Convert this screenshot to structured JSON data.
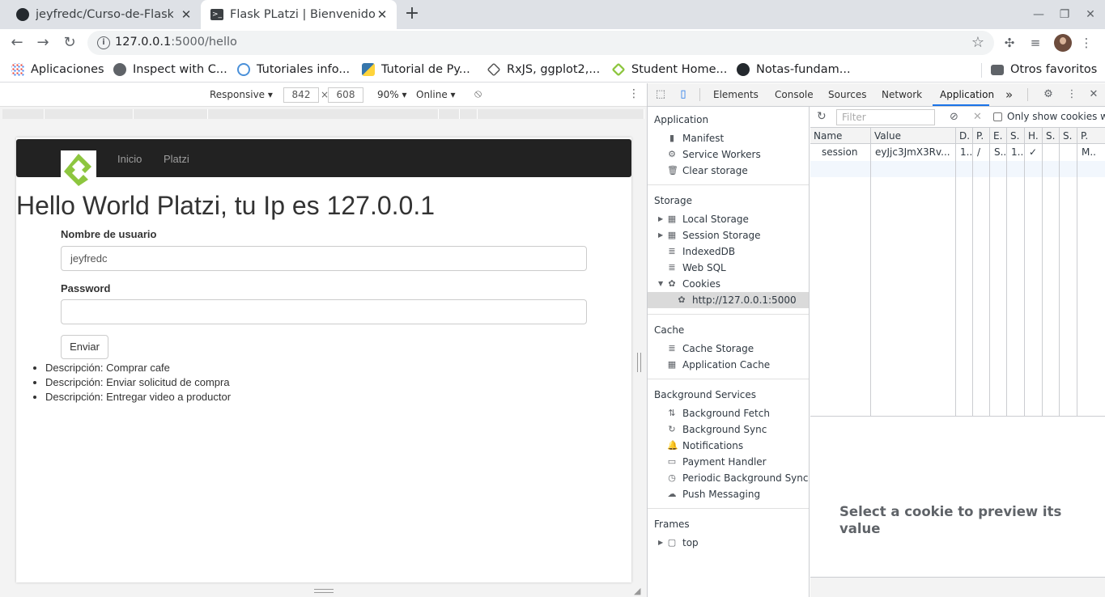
{
  "browser": {
    "tabs": [
      {
        "title": "jeyfredc/Curso-de-Flask: C",
        "icon": "github-icon",
        "active": false
      },
      {
        "title": "Flask PLatzi | Bienvenido",
        "icon": "terminal-icon",
        "active": true
      }
    ],
    "url_host": "127.0.0.1",
    "url_rest": ":5000/hello",
    "bookmarks": [
      {
        "label": "Aplicaciones",
        "icon": "apps-grid-icon"
      },
      {
        "label": "Inspect with C...",
        "icon": "globe-icon"
      },
      {
        "label": "Tutoriales info...",
        "icon": "q-icon"
      },
      {
        "label": "Tutorial de Py...",
        "icon": "python-icon"
      },
      {
        "label": "RxJS, ggplot2,...",
        "icon": "diamond-icon"
      },
      {
        "label": "Student Home...",
        "icon": "student-icon"
      },
      {
        "label": "Notas-fundam...",
        "icon": "github-icon"
      }
    ],
    "other_bookmarks": "Otros favoritos"
  },
  "device_toolbar": {
    "mode": "Responsive",
    "width": "842",
    "times": "×",
    "height": "608",
    "zoom": "90%",
    "network": "Online"
  },
  "page": {
    "nav": [
      "Inicio",
      "Platzi"
    ],
    "heading": "Hello World Platzi, tu Ip es 127.0.0.1",
    "username_label": "Nombre de usuario",
    "username_value": "jeyfredc",
    "password_label": "Password",
    "submit_label": "Enviar",
    "tasks": [
      "Descripción: Comprar cafe",
      "Descripción: Enviar solicitud de compra",
      "Descripción: Entregar video a productor"
    ]
  },
  "devtools": {
    "tabs": [
      "Elements",
      "Console",
      "Sources",
      "Network",
      "Application"
    ],
    "active_tab": "Application",
    "more": "»",
    "sections": {
      "application": {
        "title": "Application",
        "items": [
          "Manifest",
          "Service Workers",
          "Clear storage"
        ]
      },
      "storage": {
        "title": "Storage",
        "items": [
          "Local Storage",
          "Session Storage",
          "IndexedDB",
          "Web SQL",
          "Cookies"
        ],
        "cookie_origin": "http://127.0.0.1:5000"
      },
      "cache": {
        "title": "Cache",
        "items": [
          "Cache Storage",
          "Application Cache"
        ]
      },
      "background": {
        "title": "Background Services",
        "items": [
          "Background Fetch",
          "Background Sync",
          "Notifications",
          "Payment Handler",
          "Periodic Background Sync",
          "Push Messaging"
        ]
      },
      "frames": {
        "title": "Frames",
        "items": [
          "top"
        ]
      }
    },
    "filter_placeholder": "Filter",
    "only_show_label": "Only show cookies wit",
    "columns": [
      "Name",
      "Value",
      "D.",
      "P.",
      "E.",
      "S.",
      "H.",
      "S.",
      "S.",
      "P."
    ],
    "cookie_row": [
      "session",
      "eyJjc3JmX3Rv...",
      "1..",
      "/",
      "S..",
      "1..",
      "✓",
      "",
      "",
      "M.."
    ],
    "preview_text": "Select a cookie to preview its value"
  },
  "colors": {
    "accent": "#1a73e8",
    "navbar": "#222222",
    "logo_green": "#8dc63f"
  }
}
